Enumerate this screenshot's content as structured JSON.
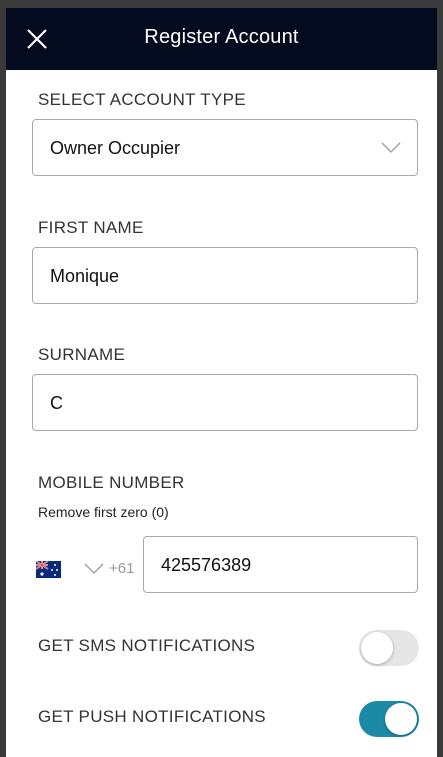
{
  "header": {
    "title": "Register Account",
    "close_icon": "close-icon"
  },
  "colors": {
    "header_bg": "#050b1f",
    "toggle_on": "#1b8aa6",
    "toggle_off": "#e6e6e6"
  },
  "account_type": {
    "label": "SELECT ACCOUNT TYPE",
    "value": "Owner Occupier"
  },
  "first_name": {
    "label": "FIRST NAME",
    "value": "Monique"
  },
  "surname": {
    "label": "SURNAME",
    "value": "C"
  },
  "mobile": {
    "label": "MOBILE NUMBER",
    "hint": "Remove first zero (0)",
    "country_flag": "australia-flag-icon",
    "country_code": "+61",
    "value": "425576389"
  },
  "sms": {
    "label": "GET SMS NOTIFICATIONS",
    "enabled": false
  },
  "push": {
    "label": "GET PUSH NOTIFICATIONS",
    "enabled": true
  }
}
